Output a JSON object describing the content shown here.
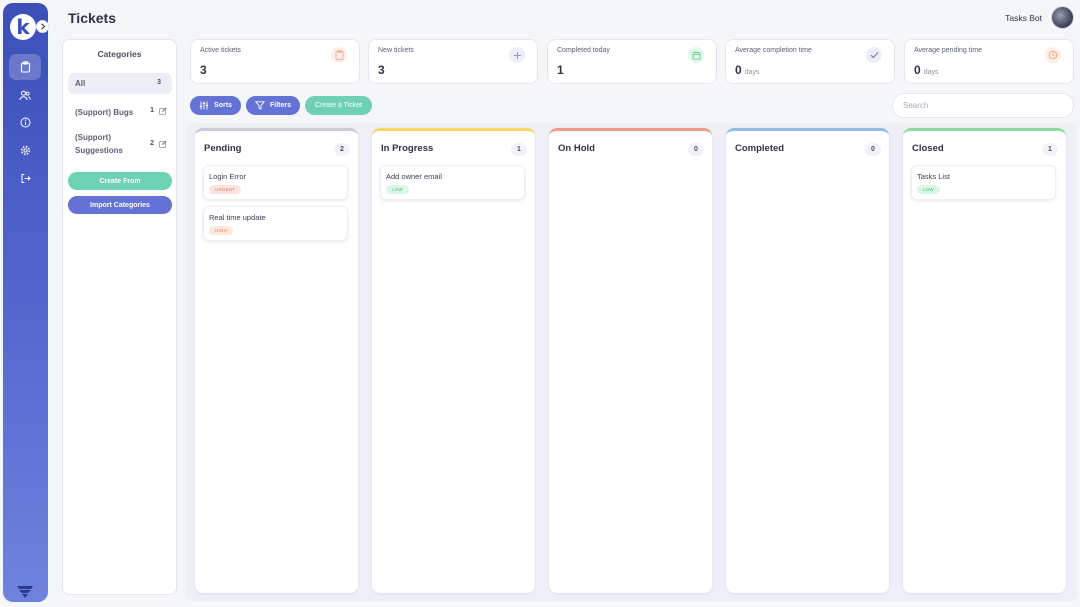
{
  "header": {
    "title": "Tickets",
    "user_name": "Tasks Bot"
  },
  "sidebar": {
    "logo_letter": "k",
    "items": [
      {
        "icon": "clipboard-icon",
        "active": true
      },
      {
        "icon": "users-icon",
        "active": false
      },
      {
        "icon": "info-icon",
        "active": false
      },
      {
        "icon": "gear-icon",
        "active": false
      },
      {
        "icon": "logout-icon",
        "active": false
      }
    ],
    "bottom_icon": "brand-mark-icon"
  },
  "categories": {
    "title": "Categories",
    "items": [
      {
        "name": "All",
        "count": "3"
      },
      {
        "name": "(Support) Bugs",
        "count": "1"
      },
      {
        "name": "(Support) Suggestions",
        "count": "2"
      }
    ],
    "create_label": "Create From",
    "import_label": "Import Categories"
  },
  "stats": [
    {
      "label": "Active tickets",
      "value": "3",
      "unit": "",
      "icon": "clipboard-icon",
      "color": "#f3a78e"
    },
    {
      "label": "New tickets",
      "value": "3",
      "unit": "",
      "icon": "plus-icon",
      "color": "#8a95c9"
    },
    {
      "label": "Completed today",
      "value": "1",
      "unit": "",
      "icon": "calendar-icon",
      "color": "#5fcf8a"
    },
    {
      "label": "Average completion time",
      "value": "0",
      "unit": "days",
      "icon": "check-icon",
      "color": "#6f7bb8"
    },
    {
      "label": "Average pending time",
      "value": "0",
      "unit": "days",
      "icon": "clock-icon",
      "color": "#f39a7a"
    }
  ],
  "toolbar": {
    "sorts_label": "Sorts",
    "filters_label": "Filters",
    "create_ticket_label": "Create a Ticket",
    "search_placeholder": "Search"
  },
  "board": {
    "columns": [
      {
        "title": "Pending",
        "count": "2",
        "accent": "#c9cbd8",
        "tickets": [
          {
            "title": "Login Error",
            "priority": "URGENT"
          },
          {
            "title": "Real time update",
            "priority": "HIGH"
          }
        ]
      },
      {
        "title": "In Progress",
        "count": "1",
        "accent": "#f5d66b",
        "tickets": [
          {
            "title": "Add owner email",
            "priority": "LOW"
          }
        ]
      },
      {
        "title": "On Hold",
        "count": "0",
        "accent": "#f29a8a",
        "tickets": []
      },
      {
        "title": "Completed",
        "count": "0",
        "accent": "#93b8ec",
        "tickets": []
      },
      {
        "title": "Closed",
        "count": "1",
        "accent": "#8ddba6",
        "tickets": [
          {
            "title": "Tasks List",
            "priority": "LOW"
          }
        ]
      }
    ]
  },
  "priority_colors": {
    "URGENT": {
      "bg": "#fde4df",
      "fg": "#e0735e"
    },
    "HIGH": {
      "bg": "#fde8dc",
      "fg": "#e58a5e"
    },
    "LOW": {
      "bg": "#ddf5e6",
      "fg": "#4dbb76"
    }
  }
}
